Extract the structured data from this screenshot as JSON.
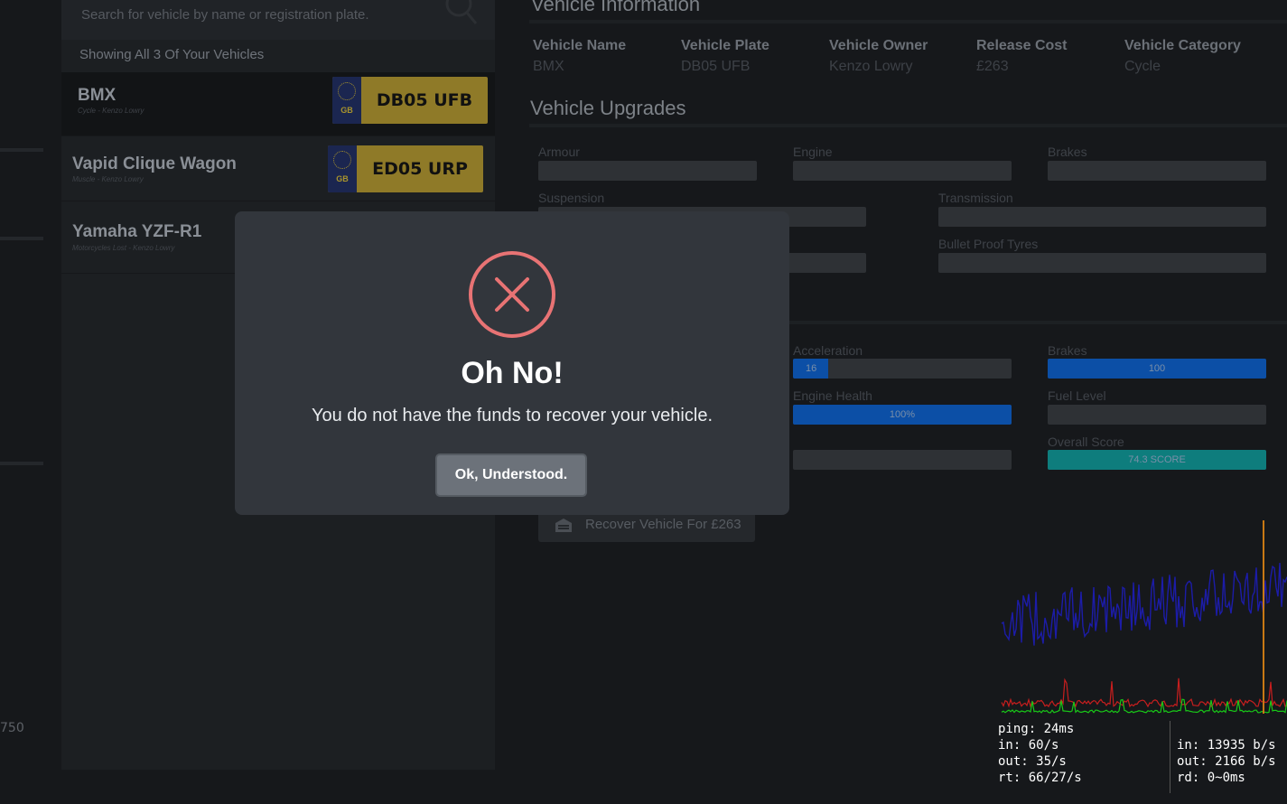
{
  "search": {
    "placeholder": "Search for vehicle by name or registration plate."
  },
  "list": {
    "count_label": "Showing All 3 Of Your Vehicles",
    "vehicles": [
      {
        "name": "BMX",
        "subtitle": "Cycle - Kenzo Lowry",
        "plate": "DB05 UFB",
        "plate_country": "GB"
      },
      {
        "name": "Vapid Clique Wagon",
        "subtitle": "Muscle - Kenzo Lowry",
        "plate": "ED05 URP",
        "plate_country": "GB"
      },
      {
        "name": "Yamaha YZF-R1",
        "subtitle": "Motorcycles Lost - Kenzo Lowry"
      }
    ]
  },
  "left_edge_number": "750",
  "info": {
    "title": "Vehicle Information",
    "fields": [
      {
        "label": "Vehicle Name",
        "value": "BMX"
      },
      {
        "label": "Vehicle Plate",
        "value": "DB05 UFB"
      },
      {
        "label": "Vehicle Owner",
        "value": "Kenzo Lowry"
      },
      {
        "label": "Release Cost",
        "value": "£263"
      },
      {
        "label": "Vehicle Category",
        "value": "Cycle"
      }
    ]
  },
  "upgrades": {
    "title": "Vehicle Upgrades",
    "labels": [
      "Armour",
      "Engine",
      "Brakes",
      "Suspension",
      "Transmission",
      "Bullet Proof Tyres"
    ]
  },
  "stats": {
    "acceleration": {
      "label": "Acceleration",
      "value": 16,
      "text": "16"
    },
    "brakes": {
      "label": "Brakes",
      "value": 100,
      "text": "100"
    },
    "engine_health": {
      "label": "Engine Health",
      "value": 100,
      "text": "100%"
    },
    "fuel_level": {
      "label": "Fuel Level",
      "value": 0
    },
    "overall_score": {
      "label": "Overall Score",
      "value": 100,
      "text": "74.3 SCORE"
    }
  },
  "recover_button": {
    "label": "Recover Vehicle For £263",
    "icon": "garage-icon"
  },
  "netgraph": {
    "left_lines": "ping: 24ms\nin: 60/s\nout: 35/s\nrt: 66/27/s",
    "right_lines": "in: 13935 b/s\nout: 2166 b/s\nrd: 0~0ms",
    "colors": {
      "blue": "#1c1ca8",
      "red": "#c81e1e",
      "green": "#18c818",
      "orange": "#c87814"
    }
  },
  "modal": {
    "icon": "error-x-icon",
    "title": "Oh No!",
    "message": "You do not have the funds to recover your vehicle.",
    "button_label": "Ok, Understood.",
    "icon_color": "#e87374"
  },
  "colors": {
    "accent_blue": "#0c4fa6",
    "accent_teal": "#0e7d7d"
  }
}
